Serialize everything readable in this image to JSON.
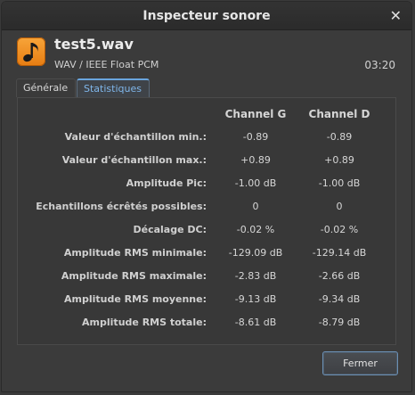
{
  "window": {
    "title": "Inspecteur sonore",
    "close_glyph": "✕"
  },
  "file": {
    "icon": "music-note-icon",
    "name": "test5.wav",
    "format": "WAV / IEEE Float PCM",
    "duration": "03:20"
  },
  "tabs": [
    {
      "label": "Générale",
      "active": false
    },
    {
      "label": "Statistiques",
      "active": true
    }
  ],
  "stats": {
    "columns": [
      "Channel G",
      "Channel D"
    ],
    "rows": [
      {
        "label": "Valeur d'échantillon min.:",
        "g": "-0.89",
        "d": "-0.89"
      },
      {
        "label": "Valeur d'échantillon max.:",
        "g": "+0.89",
        "d": "+0.89"
      },
      {
        "label": "Amplitude Pic:",
        "g": "-1.00 dB",
        "d": "-1.00 dB"
      },
      {
        "label": "Echantillons écrêtés possibles:",
        "g": "0",
        "d": "0"
      },
      {
        "label": "Décalage DC:",
        "g": "-0.02 %",
        "d": "-0.02 %"
      },
      {
        "label": "Amplitude RMS minimale:",
        "g": "-129.09 dB",
        "d": "-129.14 dB"
      },
      {
        "label": "Amplitude RMS maximale:",
        "g": "-2.83 dB",
        "d": "-2.66 dB"
      },
      {
        "label": "Amplitude RMS moyenne:",
        "g": "-9.13 dB",
        "d": "-9.34 dB"
      },
      {
        "label": "Amplitude RMS totale:",
        "g": "-8.61 dB",
        "d": "-8.79 dB"
      }
    ]
  },
  "footer": {
    "close_button": "Fermer"
  },
  "colors": {
    "accent": "#6aa5de",
    "icon": "#f0932a"
  }
}
